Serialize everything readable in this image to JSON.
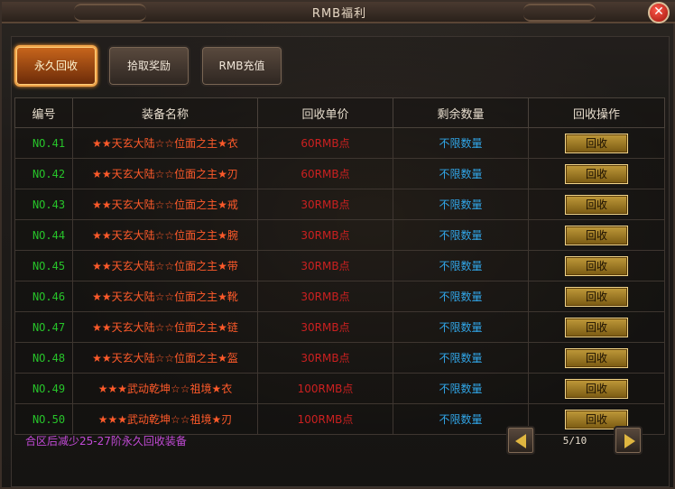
{
  "window": {
    "title": "RMB福利",
    "close_label": "✕"
  },
  "tabs": [
    {
      "label": "永久回收",
      "active": true
    },
    {
      "label": "拾取奖励",
      "active": false
    },
    {
      "label": "RMB充值",
      "active": false
    }
  ],
  "table": {
    "headers": [
      "编号",
      "装备名称",
      "回收单价",
      "剩余数量",
      "回收操作"
    ],
    "rows": [
      {
        "no": "NO.41",
        "name": "★★天玄大陆☆☆位面之主★衣",
        "price": "60RMB点",
        "qty": "不限数量",
        "action": "回收"
      },
      {
        "no": "NO.42",
        "name": "★★天玄大陆☆☆位面之主★刃",
        "price": "60RMB点",
        "qty": "不限数量",
        "action": "回收"
      },
      {
        "no": "NO.43",
        "name": "★★天玄大陆☆☆位面之主★戒",
        "price": "30RMB点",
        "qty": "不限数量",
        "action": "回收"
      },
      {
        "no": "NO.44",
        "name": "★★天玄大陆☆☆位面之主★腕",
        "price": "30RMB点",
        "qty": "不限数量",
        "action": "回收"
      },
      {
        "no": "NO.45",
        "name": "★★天玄大陆☆☆位面之主★带",
        "price": "30RMB点",
        "qty": "不限数量",
        "action": "回收"
      },
      {
        "no": "NO.46",
        "name": "★★天玄大陆☆☆位面之主★靴",
        "price": "30RMB点",
        "qty": "不限数量",
        "action": "回收"
      },
      {
        "no": "NO.47",
        "name": "★★天玄大陆☆☆位面之主★链",
        "price": "30RMB点",
        "qty": "不限数量",
        "action": "回收"
      },
      {
        "no": "NO.48",
        "name": "★★天玄大陆☆☆位面之主★盔",
        "price": "30RMB点",
        "qty": "不限数量",
        "action": "回收"
      },
      {
        "no": "NO.49",
        "name": "★★★武动乾坤☆☆祖境★衣",
        "price": "100RMB点",
        "qty": "不限数量",
        "action": "回收"
      },
      {
        "no": "NO.50",
        "name": "★★★武动乾坤☆☆祖境★刃",
        "price": "100RMB点",
        "qty": "不限数量",
        "action": "回收"
      }
    ]
  },
  "footer": {
    "note": "合区后减少25-27阶永久回收装备",
    "page": "5/10",
    "prev_icon": "triangle-left-icon",
    "next_icon": "triangle-right-icon"
  },
  "colors": {
    "number": "#27c42a",
    "item_name": "#ff5a2a",
    "price": "#cc2020",
    "quantity": "#31a6e8",
    "note": "#c24ad6",
    "active_tab": "#c9661c"
  }
}
